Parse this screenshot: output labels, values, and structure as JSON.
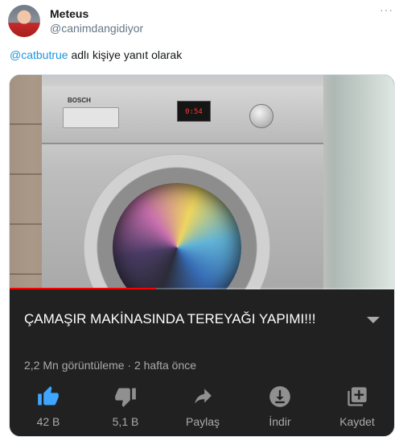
{
  "tweet": {
    "display_name": "Meteus",
    "handle": "@canimdangidiyor",
    "reply_prefix": "@catbutrue",
    "reply_suffix": " adlı kişiye yanıt olarak",
    "more_icon": "more-dots-icon"
  },
  "video": {
    "display_reading": "0:54",
    "brand": "BOSCH",
    "progress_fraction": 0.38,
    "accent_color": "#ff0000"
  },
  "youtube": {
    "title": "ÇAMAŞIR MAKİNASINDA TEREYAĞI YAPIMI!!!",
    "meta": "2,2 Mn görüntüleme · 2 hafta önce",
    "actions": [
      {
        "icon": "thumbs-up-icon",
        "label": "42 B",
        "color": "#3ea6ff"
      },
      {
        "icon": "thumbs-down-icon",
        "label": "5,1 B",
        "color": "#909090"
      },
      {
        "icon": "share-icon",
        "label": "Paylaş",
        "color": "#909090"
      },
      {
        "icon": "download-icon",
        "label": "İndir",
        "color": "#909090"
      },
      {
        "icon": "save-playlist-icon",
        "label": "Kaydet",
        "color": "#909090"
      }
    ]
  }
}
